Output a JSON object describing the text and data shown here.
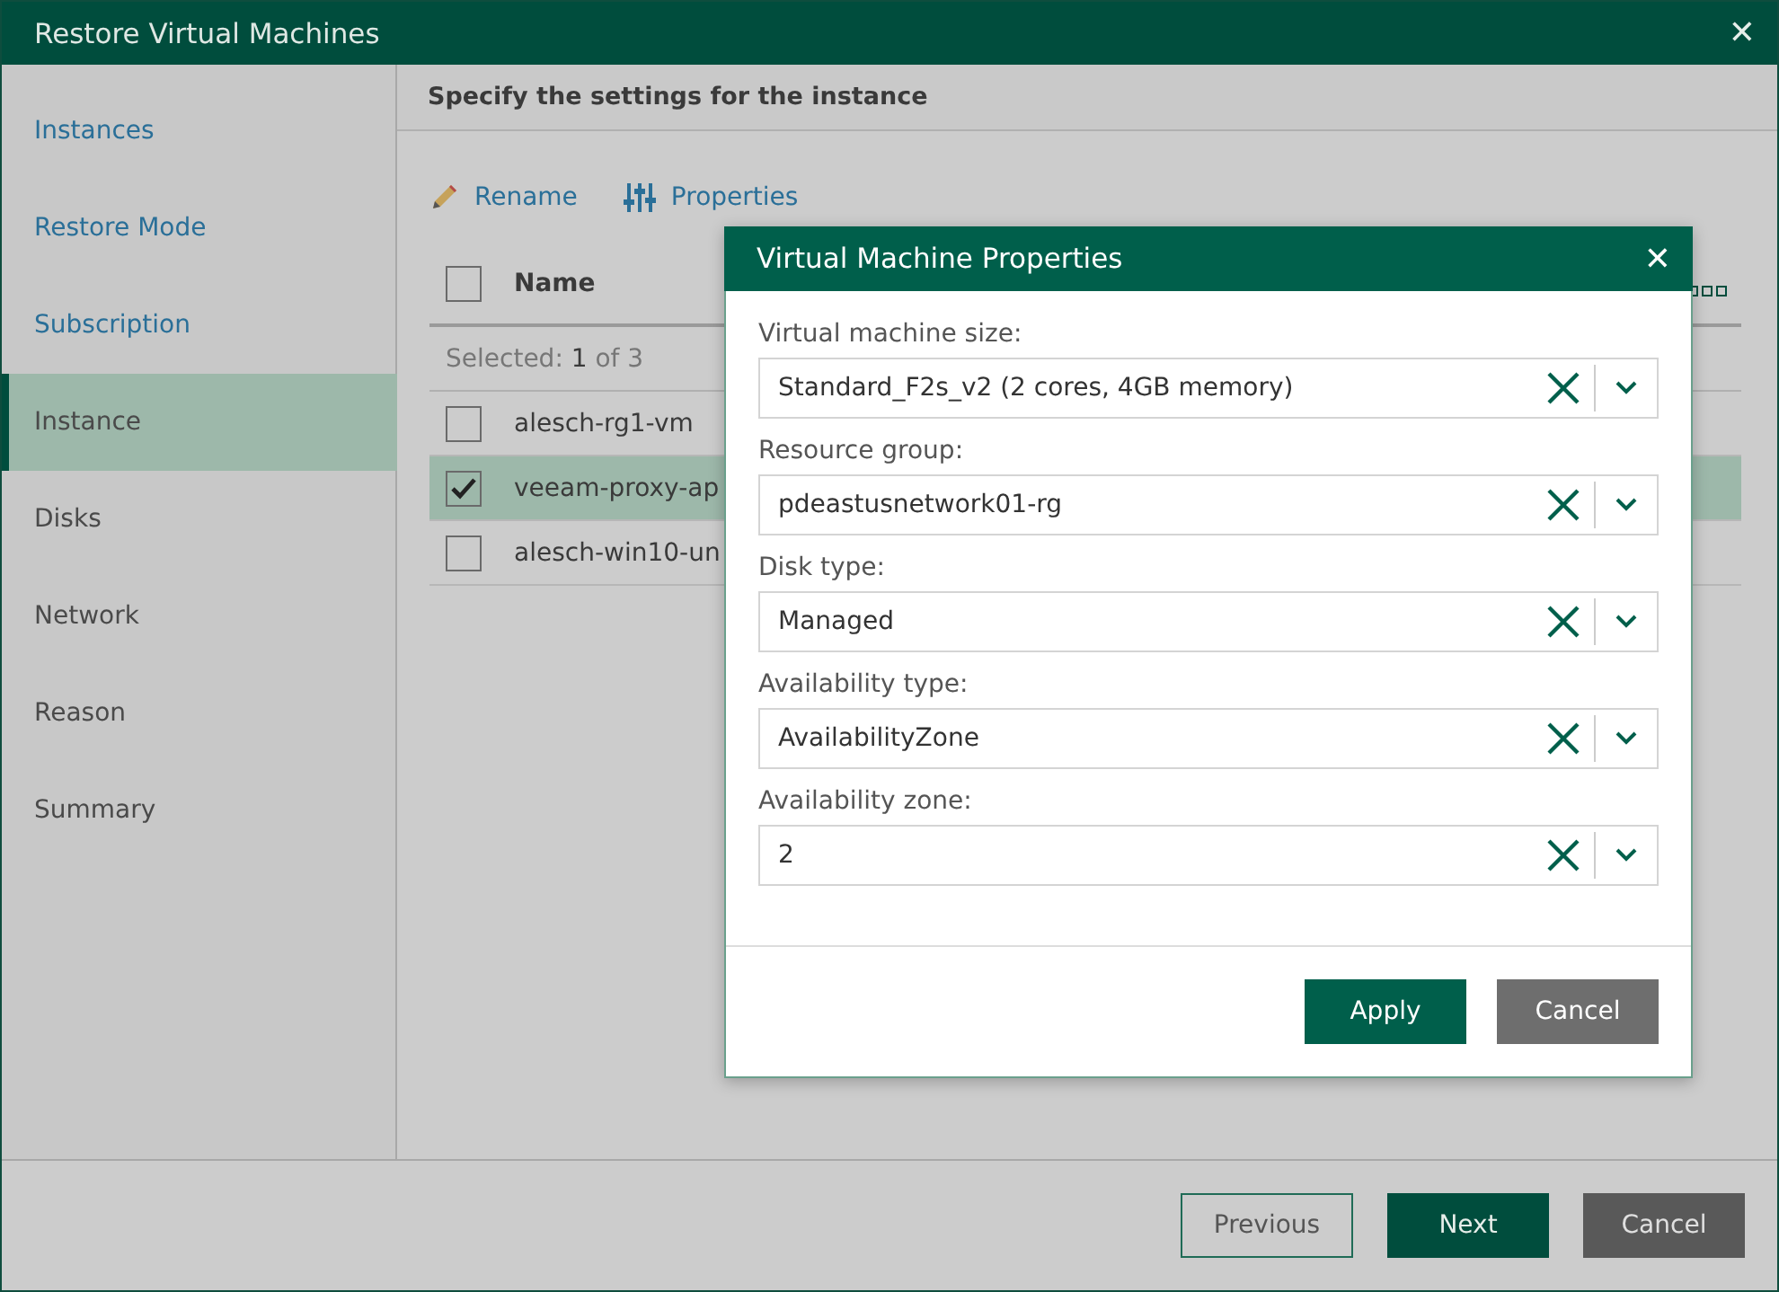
{
  "window": {
    "title": "Restore Virtual Machines",
    "close": "✕"
  },
  "sidebar": {
    "items": [
      {
        "label": "Instances",
        "visited": true,
        "selected": false
      },
      {
        "label": "Restore Mode",
        "visited": true,
        "selected": false
      },
      {
        "label": "Subscription",
        "visited": true,
        "selected": false
      },
      {
        "label": "Instance",
        "visited": false,
        "selected": true
      },
      {
        "label": "Disks",
        "visited": false,
        "selected": false
      },
      {
        "label": "Network",
        "visited": false,
        "selected": false
      },
      {
        "label": "Reason",
        "visited": false,
        "selected": false
      },
      {
        "label": "Summary",
        "visited": false,
        "selected": false
      }
    ]
  },
  "page": {
    "heading": "Specify the settings for the instance",
    "toolbar": [
      {
        "kind": "rename",
        "label": "Rename"
      },
      {
        "kind": "properties",
        "label": "Properties"
      }
    ],
    "table": {
      "header": {
        "label": "Name",
        "checked": false
      },
      "selection_summary": "Selected:  **1** of 3",
      "rows": [
        {
          "name": "alesch-rg1-vm",
          "checked": false,
          "selected": false
        },
        {
          "name": "veeam-proxy-ap",
          "checked": true,
          "selected": true
        },
        {
          "name": "alesch-win10-un",
          "checked": false,
          "selected": false
        }
      ]
    }
  },
  "dialog": {
    "title": "Virtual Machine Properties",
    "close": "✕",
    "fields": [
      {
        "label": "Virtual machine size:",
        "value": "Standard_F2s_v2 (2 cores, 4GB memory)"
      },
      {
        "label": "Resource group:",
        "value": "pdeastusnetwork01-rg"
      },
      {
        "label": "Disk type:",
        "value": "Managed"
      },
      {
        "label": "Availability type:",
        "value": "AvailabilityZone"
      },
      {
        "label": "Availability zone:",
        "value": "2"
      }
    ],
    "buttons": [
      {
        "label": "Apply",
        "kind": "primary"
      },
      {
        "label": "Cancel",
        "kind": "secondary"
      }
    ]
  },
  "footer": {
    "buttons": [
      {
        "label": "Previous",
        "kind": "outline"
      },
      {
        "label": "Next",
        "kind": "primary"
      },
      {
        "label": "Cancel",
        "kind": "secondary"
      }
    ]
  }
}
